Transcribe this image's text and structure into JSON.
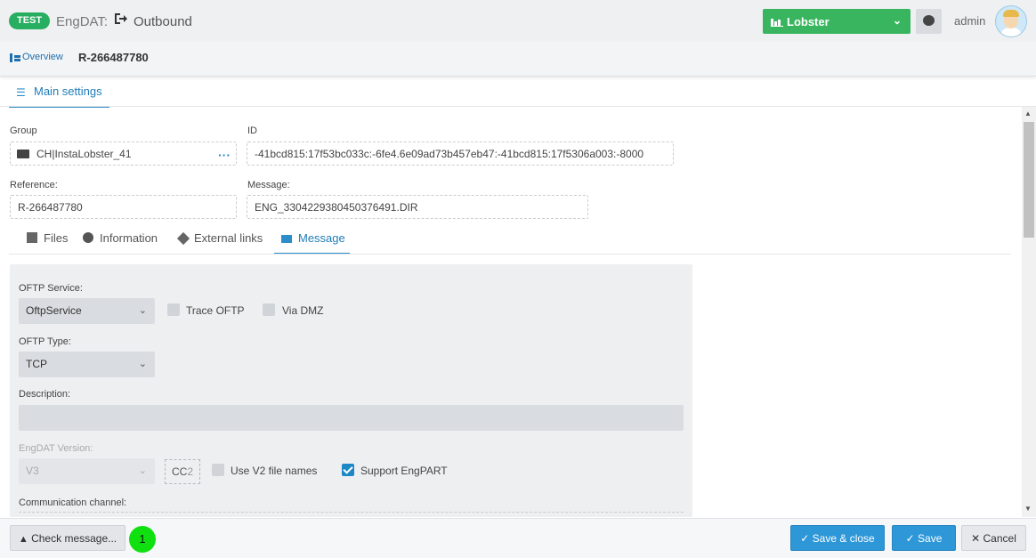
{
  "header": {
    "env_badge": "TEST",
    "app_name": "EngDAT:",
    "module": "Outbound",
    "profile": "Lobster",
    "user": "admin"
  },
  "breadcrumb": {
    "link": "Overview",
    "title": "R-266487780"
  },
  "main_tab": "Main settings",
  "fields": {
    "group_label": "Group",
    "group_value": "CH|InstaLobster_41",
    "id_label": "ID",
    "id_value": "-41bcd815:17f53bc033c:-6fe4.6e09ad73b457eb47:-41bcd815:17f5306a003:-8000",
    "reference_label": "Reference:",
    "reference_value": "R-266487780",
    "message_label": "Message:",
    "message_value": "ENG_3304229380450376491.DIR"
  },
  "sub_tabs": [
    {
      "label": "Files"
    },
    {
      "label": "Information"
    },
    {
      "label": "External links"
    },
    {
      "label": "Message"
    }
  ],
  "message_panel": {
    "oftp_service_label": "OFTP Service:",
    "oftp_service_value": "OftpService",
    "trace_oftp": "Trace OFTP",
    "via_dmz": "Via DMZ",
    "oftp_type_label": "OFTP Type:",
    "oftp_type_value": "TCP",
    "description_label": "Description:",
    "engdat_version_label": "EngDAT Version:",
    "engdat_version_value": "V3",
    "cc_prefix": "CC",
    "cc_number": "2",
    "use_v2": "Use V2 file names",
    "support_engpart": "Support EngPART",
    "comm_channel_label": "Communication channel:"
  },
  "footer": {
    "check_message": "Check message...",
    "badge_count": "1",
    "save_close": "Save & close",
    "save": "Save",
    "cancel": "Cancel"
  },
  "colors": {
    "accent": "#2b8ecb",
    "profile_green": "#3ab55f",
    "test_badge": "#27ae60",
    "count_badge": "#10e010"
  }
}
